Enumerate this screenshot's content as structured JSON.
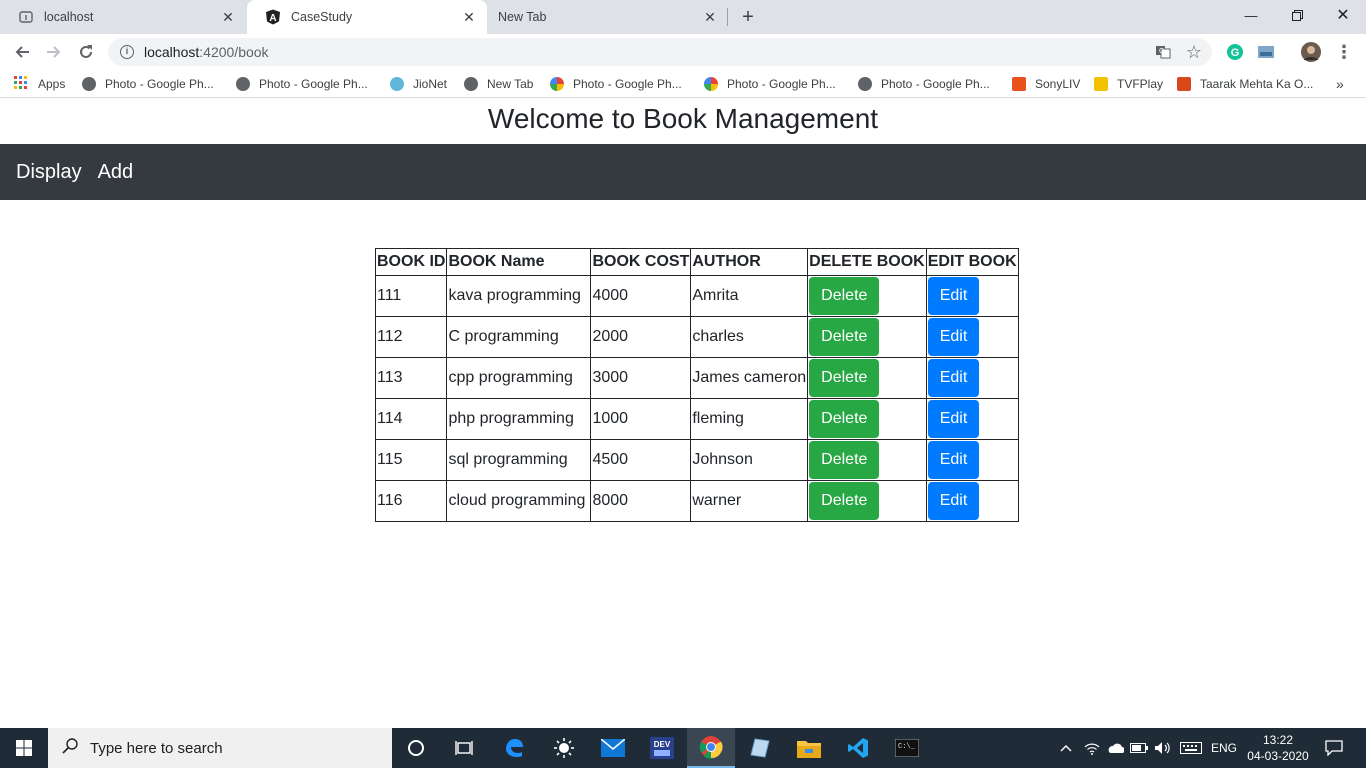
{
  "browser": {
    "tabs": [
      {
        "title": "localhost"
      },
      {
        "title": "CaseStudy"
      },
      {
        "title": "New Tab"
      }
    ],
    "url_host": "localhost",
    "url_path": ":4200/book",
    "bookmarks": [
      {
        "label": "Apps"
      },
      {
        "label": "Photo - Google Ph..."
      },
      {
        "label": "Photo - Google Ph..."
      },
      {
        "label": "JioNet"
      },
      {
        "label": "New Tab"
      },
      {
        "label": "Photo - Google Ph..."
      },
      {
        "label": "Photo - Google Ph..."
      },
      {
        "label": "Photo - Google Ph..."
      },
      {
        "label": "SonyLIV"
      },
      {
        "label": "TVFPlay"
      },
      {
        "label": "Taarak Mehta Ka O..."
      }
    ],
    "more_bookmarks": "»"
  },
  "page": {
    "title": "Welcome to Book Management",
    "nav": {
      "display": "Display",
      "add": "Add"
    },
    "table": {
      "headers": [
        "BOOK ID",
        "BOOK Name",
        "BOOK COST",
        "AUTHOR",
        "DELETE BOOK",
        "EDIT BOOK"
      ],
      "rows": [
        {
          "id": "111",
          "name": "kava programming",
          "cost": "4000",
          "author": "Amrita"
        },
        {
          "id": "112",
          "name": "C programming",
          "cost": "2000",
          "author": "charles"
        },
        {
          "id": "113",
          "name": "cpp programming",
          "cost": "3000",
          "author": "James cameron"
        },
        {
          "id": "114",
          "name": "php programming",
          "cost": "1000",
          "author": "fleming"
        },
        {
          "id": "115",
          "name": "sql programming",
          "cost": "4500",
          "author": "Johnson"
        },
        {
          "id": "116",
          "name": "cloud programming",
          "cost": "8000",
          "author": "warner"
        }
      ],
      "delete_label": "Delete",
      "edit_label": "Edit"
    },
    "colors": {
      "navbar": "#343a40",
      "delete": "#28a745",
      "edit": "#007bff"
    }
  },
  "taskbar": {
    "search_placeholder": "Type here to search",
    "language": "ENG",
    "time": "13:22",
    "date": "04-03-2020"
  }
}
